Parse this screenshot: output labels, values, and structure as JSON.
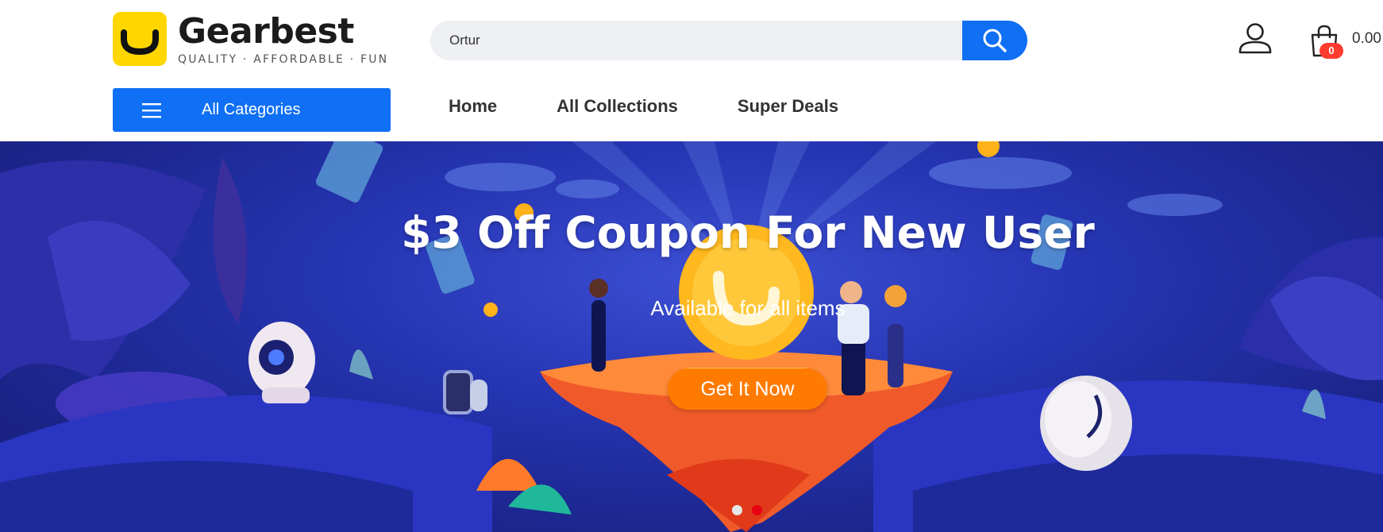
{
  "brand": {
    "name": "Gearbest",
    "tagline": "QUALITY · AFFORDABLE · FUN",
    "logo_color": "#ffd600"
  },
  "search": {
    "value": "Ortur",
    "button_icon": "search-icon",
    "accent": "#0f6ff5"
  },
  "account": {
    "icon": "user-icon"
  },
  "cart": {
    "icon": "shopping-bag-icon",
    "count": "0",
    "total": "0.00"
  },
  "categories_button": {
    "icon": "menu-icon",
    "label": "All Categories"
  },
  "nav": {
    "items": [
      {
        "label": "Home"
      },
      {
        "label": "All Collections"
      },
      {
        "label": "Super Deals"
      }
    ]
  },
  "banner": {
    "title": "$3 Off Coupon For New User",
    "subtitle": "Available for all items",
    "cta_label": "Get It Now",
    "cta_color": "#ff7a00",
    "slides": [
      {
        "active": false,
        "color": "#e6e6e6"
      },
      {
        "active": true,
        "color": "#e60012"
      }
    ]
  }
}
